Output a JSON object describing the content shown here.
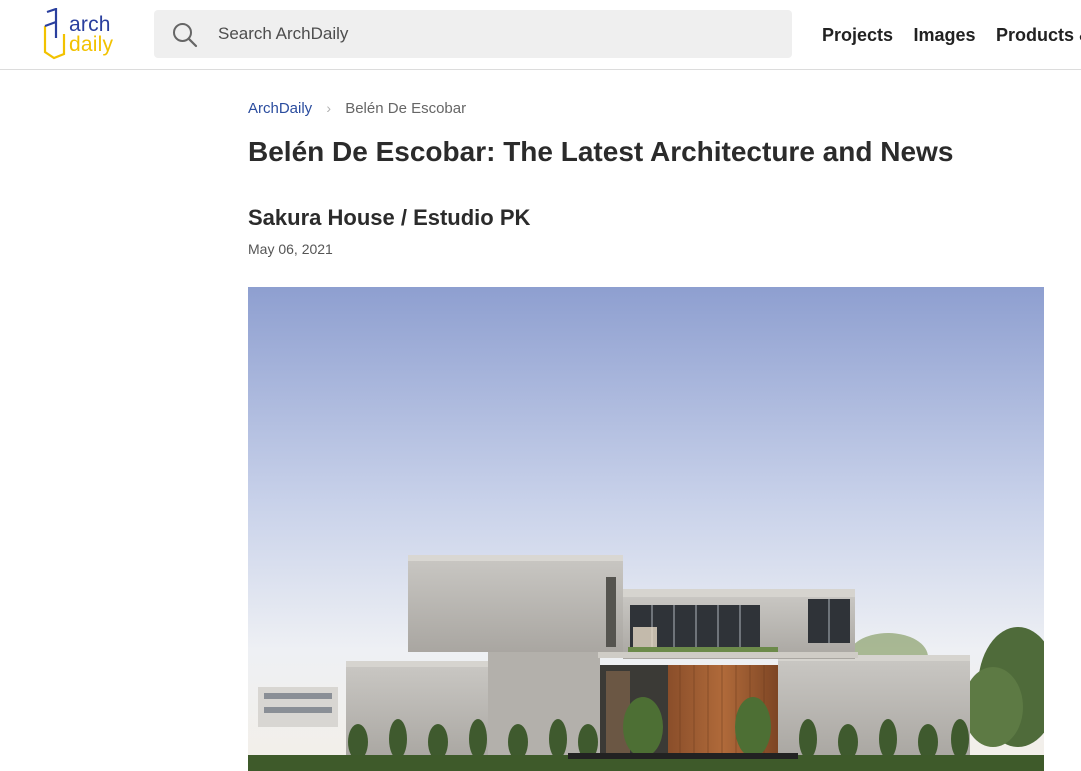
{
  "header": {
    "logo": {
      "line1": "arch",
      "line2": "daily",
      "brand_blue": "#2a3f9e",
      "brand_yellow": "#f2c200"
    },
    "search": {
      "placeholder": "Search ArchDaily",
      "value": "",
      "icon": "search-icon"
    },
    "nav": [
      {
        "label": "Projects"
      },
      {
        "label": "Images"
      },
      {
        "label": "Products &"
      }
    ]
  },
  "breadcrumb": {
    "home": "ArchDaily",
    "separator": "›",
    "current": "Belén De Escobar"
  },
  "page": {
    "title": "Belén De Escobar: The Latest Architecture and News"
  },
  "article": {
    "title": "Sakura House / Estudio PK",
    "date": "May 06, 2021",
    "image_subject": "concrete house photo"
  },
  "colors": {
    "link": "#2a4c9e",
    "header_border": "#dcdcdc",
    "search_bg": "#efefef"
  }
}
